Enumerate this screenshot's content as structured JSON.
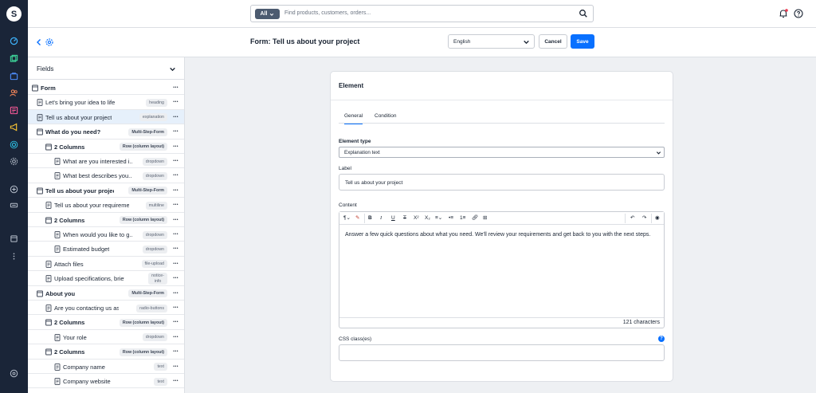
{
  "search": {
    "filter_label": "All",
    "placeholder": "Find products, customers, orders..."
  },
  "header": {
    "title": "Form: Tell us about your project",
    "language": "English",
    "cancel_label": "Cancel",
    "save_label": "Save"
  },
  "rail": {
    "icons": [
      "dashboard-icon",
      "catalog-icon",
      "orders-icon",
      "customers-icon",
      "content-icon",
      "marketing-icon",
      "extensions-icon",
      "settings-icon",
      "add-icon",
      "sales-channel-icon",
      "shop-icon",
      "more-icon",
      "help-icon"
    ]
  },
  "fields_panel": {
    "title": "Fields",
    "rows": [
      {
        "label": "Form",
        "tag": "",
        "bold": true,
        "level": 0,
        "icon": "folder-icon"
      },
      {
        "label": "Let's bring your idea to life",
        "tag": "heading",
        "bold": false,
        "level": 1,
        "icon": "document-icon"
      },
      {
        "label": "Tell us about your project",
        "tag": "explanation",
        "bold": false,
        "level": 1,
        "icon": "document-icon",
        "selected": true
      },
      {
        "label": "What do you need?",
        "tag": "Multi-Step-Form",
        "bold": true,
        "level": 1,
        "icon": "folder-icon"
      },
      {
        "label": "2 Columns",
        "tag": "Row (column layout)",
        "bold": true,
        "level": 2,
        "icon": "folder-icon"
      },
      {
        "label": "What are you interested i...",
        "tag": "dropdown",
        "bold": false,
        "level": 3,
        "icon": "document-icon"
      },
      {
        "label": "What best describes you...",
        "tag": "dropdown",
        "bold": false,
        "level": 3,
        "icon": "document-icon"
      },
      {
        "label": "Tell us about your project",
        "tag": "Multi-Step-Form",
        "bold": true,
        "level": 1,
        "icon": "folder-icon"
      },
      {
        "label": "Tell us about your requirements",
        "tag": "multiline",
        "bold": false,
        "level": 2,
        "icon": "document-icon"
      },
      {
        "label": "2 Columns",
        "tag": "Row (column layout)",
        "bold": true,
        "level": 2,
        "icon": "folder-icon"
      },
      {
        "label": "When would you like to g...",
        "tag": "dropdown",
        "bold": false,
        "level": 3,
        "icon": "document-icon"
      },
      {
        "label": "Estimated budget",
        "tag": "dropdown",
        "bold": false,
        "level": 3,
        "icon": "document-icon"
      },
      {
        "label": "Attach files",
        "tag": "file-upload",
        "bold": false,
        "level": 2,
        "icon": "document-icon"
      },
      {
        "label": "Upload specifications, brief, re...",
        "tag": "notice-info",
        "bold": false,
        "level": 2,
        "icon": "document-icon",
        "tag_lines": [
          "notice-",
          "info"
        ]
      },
      {
        "label": "About you",
        "tag": "Multi-Step-Form",
        "bold": true,
        "level": 1,
        "icon": "folder-icon"
      },
      {
        "label": "Are you contacting us as?",
        "tag": "radio-buttons",
        "bold": false,
        "level": 2,
        "icon": "document-icon"
      },
      {
        "label": "2 Columns",
        "tag": "Row (column layout)",
        "bold": true,
        "level": 2,
        "icon": "folder-icon"
      },
      {
        "label": "Your role",
        "tag": "dropdown",
        "bold": false,
        "level": 3,
        "icon": "document-icon"
      },
      {
        "label": "2 Columns",
        "tag": "Row (column layout)",
        "bold": true,
        "level": 2,
        "icon": "folder-icon"
      },
      {
        "label": "Company name",
        "tag": "text",
        "bold": false,
        "level": 3,
        "icon": "document-icon"
      },
      {
        "label": "Company website",
        "tag": "text",
        "bold": false,
        "level": 3,
        "icon": "document-icon"
      }
    ]
  },
  "element": {
    "title": "Element",
    "tabs": [
      {
        "label": "General",
        "active": true
      },
      {
        "label": "Condition",
        "active": false
      }
    ],
    "element_type_label": "Element type",
    "element_type_value": "Explanation text",
    "label_label": "Label",
    "label_value": "Tell us about your project",
    "content_label": "Content",
    "content_text": "Answer a few quick questions about what you need. We'll review your requirements and get back to you with the next steps.",
    "char_count": "121 characters",
    "css_label": "CSS class(es)",
    "css_value": "",
    "help_glyph": "?"
  },
  "colors": {
    "rail": "#1a2538",
    "accent": "#0870ff",
    "selected_row": "#e6f0fb"
  }
}
